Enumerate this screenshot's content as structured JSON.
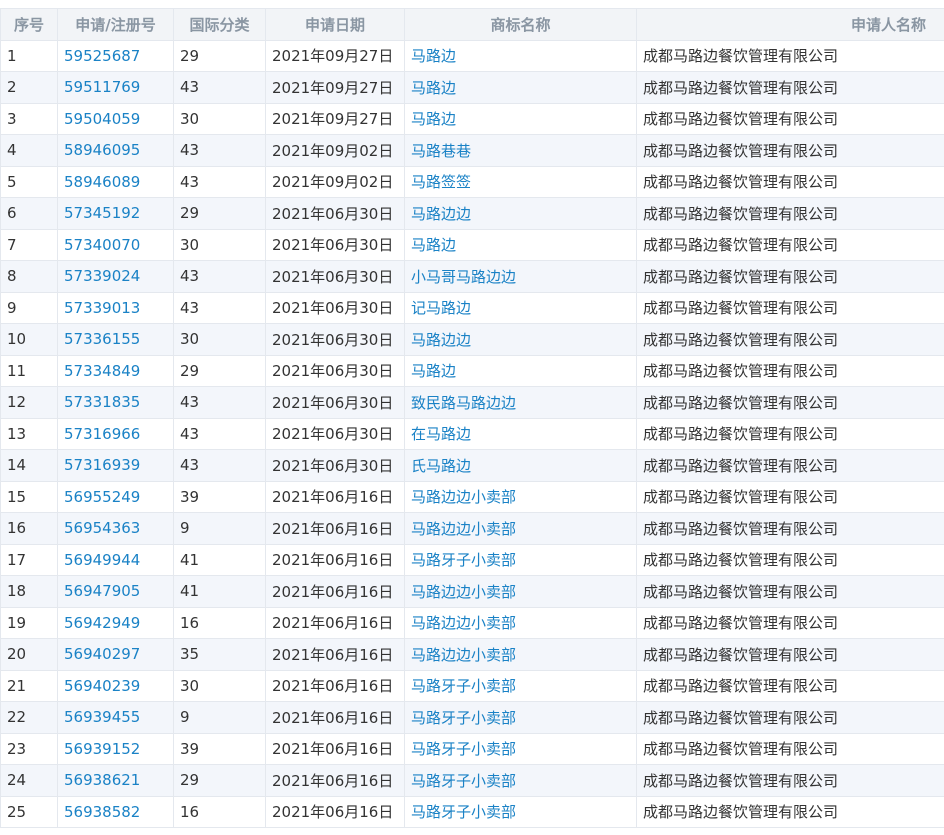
{
  "table": {
    "headers": [
      "序号",
      "申请/注册号",
      "国际分类",
      "申请日期",
      "商标名称",
      "申请人名称"
    ],
    "rows": [
      {
        "no": "1",
        "reg": "59525687",
        "cls": "29",
        "date": "2021年09月27日",
        "mark": "马路边",
        "applicant": "成都马路边餐饮管理有限公司"
      },
      {
        "no": "2",
        "reg": "59511769",
        "cls": "43",
        "date": "2021年09月27日",
        "mark": "马路边",
        "applicant": "成都马路边餐饮管理有限公司"
      },
      {
        "no": "3",
        "reg": "59504059",
        "cls": "30",
        "date": "2021年09月27日",
        "mark": "马路边",
        "applicant": "成都马路边餐饮管理有限公司"
      },
      {
        "no": "4",
        "reg": "58946095",
        "cls": "43",
        "date": "2021年09月02日",
        "mark": "马路巷巷",
        "applicant": "成都马路边餐饮管理有限公司"
      },
      {
        "no": "5",
        "reg": "58946089",
        "cls": "43",
        "date": "2021年09月02日",
        "mark": "马路签签",
        "applicant": "成都马路边餐饮管理有限公司"
      },
      {
        "no": "6",
        "reg": "57345192",
        "cls": "29",
        "date": "2021年06月30日",
        "mark": "马路边边",
        "applicant": "成都马路边餐饮管理有限公司"
      },
      {
        "no": "7",
        "reg": "57340070",
        "cls": "30",
        "date": "2021年06月30日",
        "mark": "马路边",
        "applicant": "成都马路边餐饮管理有限公司"
      },
      {
        "no": "8",
        "reg": "57339024",
        "cls": "43",
        "date": "2021年06月30日",
        "mark": "小马哥马路边边",
        "applicant": "成都马路边餐饮管理有限公司"
      },
      {
        "no": "9",
        "reg": "57339013",
        "cls": "43",
        "date": "2021年06月30日",
        "mark": "记马路边",
        "applicant": "成都马路边餐饮管理有限公司"
      },
      {
        "no": "10",
        "reg": "57336155",
        "cls": "30",
        "date": "2021年06月30日",
        "mark": "马路边边",
        "applicant": "成都马路边餐饮管理有限公司"
      },
      {
        "no": "11",
        "reg": "57334849",
        "cls": "29",
        "date": "2021年06月30日",
        "mark": "马路边",
        "applicant": "成都马路边餐饮管理有限公司"
      },
      {
        "no": "12",
        "reg": "57331835",
        "cls": "43",
        "date": "2021年06月30日",
        "mark": "致民路马路边边",
        "applicant": "成都马路边餐饮管理有限公司"
      },
      {
        "no": "13",
        "reg": "57316966",
        "cls": "43",
        "date": "2021年06月30日",
        "mark": "在马路边",
        "applicant": "成都马路边餐饮管理有限公司"
      },
      {
        "no": "14",
        "reg": "57316939",
        "cls": "43",
        "date": "2021年06月30日",
        "mark": "氏马路边",
        "applicant": "成都马路边餐饮管理有限公司"
      },
      {
        "no": "15",
        "reg": "56955249",
        "cls": "39",
        "date": "2021年06月16日",
        "mark": "马路边边小卖部",
        "applicant": "成都马路边餐饮管理有限公司"
      },
      {
        "no": "16",
        "reg": "56954363",
        "cls": "9",
        "date": "2021年06月16日",
        "mark": "马路边边小卖部",
        "applicant": "成都马路边餐饮管理有限公司"
      },
      {
        "no": "17",
        "reg": "56949944",
        "cls": "41",
        "date": "2021年06月16日",
        "mark": "马路牙子小卖部",
        "applicant": "成都马路边餐饮管理有限公司"
      },
      {
        "no": "18",
        "reg": "56947905",
        "cls": "41",
        "date": "2021年06月16日",
        "mark": "马路边边小卖部",
        "applicant": "成都马路边餐饮管理有限公司"
      },
      {
        "no": "19",
        "reg": "56942949",
        "cls": "16",
        "date": "2021年06月16日",
        "mark": "马路边边小卖部",
        "applicant": "成都马路边餐饮管理有限公司"
      },
      {
        "no": "20",
        "reg": "56940297",
        "cls": "35",
        "date": "2021年06月16日",
        "mark": "马路边边小卖部",
        "applicant": "成都马路边餐饮管理有限公司"
      },
      {
        "no": "21",
        "reg": "56940239",
        "cls": "30",
        "date": "2021年06月16日",
        "mark": "马路牙子小卖部",
        "applicant": "成都马路边餐饮管理有限公司"
      },
      {
        "no": "22",
        "reg": "56939455",
        "cls": "9",
        "date": "2021年06月16日",
        "mark": "马路牙子小卖部",
        "applicant": "成都马路边餐饮管理有限公司"
      },
      {
        "no": "23",
        "reg": "56939152",
        "cls": "39",
        "date": "2021年06月16日",
        "mark": "马路牙子小卖部",
        "applicant": "成都马路边餐饮管理有限公司"
      },
      {
        "no": "24",
        "reg": "56938621",
        "cls": "29",
        "date": "2021年06月16日",
        "mark": "马路牙子小卖部",
        "applicant": "成都马路边餐饮管理有限公司"
      },
      {
        "no": "25",
        "reg": "56938582",
        "cls": "16",
        "date": "2021年06月16日",
        "mark": "马路牙子小卖部",
        "applicant": "成都马路边餐饮管理有限公司"
      }
    ]
  },
  "colors": {
    "header_bg": "#f2f4f7",
    "header_text": "#8a96a3",
    "alt_row_bg": "#f3f6fb",
    "link": "#1a82c6",
    "border": "#e4e8ee"
  }
}
